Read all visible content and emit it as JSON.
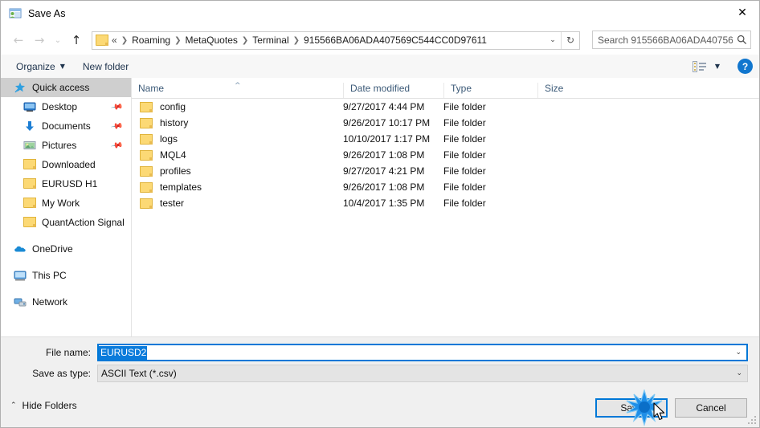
{
  "window": {
    "title": "Save As",
    "icon": "save-as-app-icon",
    "close_label": "✕"
  },
  "nav": {
    "back_icon": "arrow-left-icon",
    "forward_icon": "arrow-right-icon",
    "recent_icon": "chevron-down-icon",
    "up_icon": "arrow-up-icon",
    "back_glyph": "←",
    "forward_glyph": "→",
    "recent_glyph": "⌄",
    "up_glyph": "↑"
  },
  "address": {
    "folder_icon": "folder-icon",
    "lead": "«",
    "crumbs": [
      "Roaming",
      "MetaQuotes",
      "Terminal",
      "915566BA06ADA407569C544CC0D97611"
    ],
    "separator": "❯",
    "dropdown_glyph": "⌄",
    "refresh_glyph": "↻"
  },
  "search": {
    "placeholder": "Search 915566BA06ADA40756...",
    "icon_glyph": "🔍"
  },
  "toolbar": {
    "organize_label": "Organize",
    "organize_caret": "▼",
    "new_folder_label": "New folder",
    "view_caret": "▼",
    "help_label": "?"
  },
  "sidebar": {
    "items": [
      {
        "label": "Quick access",
        "icon": "star-pin-icon",
        "level": "root",
        "selected": true,
        "pinned": false
      },
      {
        "label": "Desktop",
        "icon": "desktop-icon",
        "level": "child",
        "selected": false,
        "pinned": true
      },
      {
        "label": "Documents",
        "icon": "documents-download-icon",
        "level": "child",
        "selected": false,
        "pinned": true
      },
      {
        "label": "Pictures",
        "icon": "pictures-icon",
        "level": "child",
        "selected": false,
        "pinned": true
      },
      {
        "label": "Downloaded",
        "icon": "folder-icon",
        "level": "child",
        "selected": false,
        "pinned": false
      },
      {
        "label": "EURUSD H1",
        "icon": "folder-icon",
        "level": "child",
        "selected": false,
        "pinned": false
      },
      {
        "label": "My Work",
        "icon": "folder-icon",
        "level": "child",
        "selected": false,
        "pinned": false
      },
      {
        "label": "QuantAction Signal",
        "icon": "folder-icon",
        "level": "child",
        "selected": false,
        "pinned": false
      },
      {
        "label": "OneDrive",
        "icon": "onedrive-cloud-icon",
        "level": "root",
        "selected": false,
        "pinned": false,
        "gap_before": true
      },
      {
        "label": "This PC",
        "icon": "this-pc-icon",
        "level": "root",
        "selected": false,
        "pinned": false,
        "gap_before": true
      },
      {
        "label": "Network",
        "icon": "network-icon",
        "level": "root",
        "selected": false,
        "pinned": false,
        "gap_before": true
      }
    ]
  },
  "filelist": {
    "columns": [
      "Name",
      "Date modified",
      "Type",
      "Size"
    ],
    "sort_caret": "^",
    "rows": [
      {
        "name": "config",
        "date": "9/27/2017 4:44 PM",
        "type": "File folder",
        "size": ""
      },
      {
        "name": "history",
        "date": "9/26/2017 10:17 PM",
        "type": "File folder",
        "size": ""
      },
      {
        "name": "logs",
        "date": "10/10/2017 1:17 PM",
        "type": "File folder",
        "size": ""
      },
      {
        "name": "MQL4",
        "date": "9/26/2017 1:08 PM",
        "type": "File folder",
        "size": ""
      },
      {
        "name": "profiles",
        "date": "9/27/2017 4:21 PM",
        "type": "File folder",
        "size": ""
      },
      {
        "name": "templates",
        "date": "9/26/2017 1:08 PM",
        "type": "File folder",
        "size": ""
      },
      {
        "name": "tester",
        "date": "10/4/2017 1:35 PM",
        "type": "File folder",
        "size": ""
      }
    ]
  },
  "form": {
    "filename_label": "File name:",
    "filename_value": "EURUSD2",
    "filetype_label": "Save as type:",
    "filetype_value": "ASCII Text (*.csv)",
    "caret_glyph": "⌄"
  },
  "footer": {
    "hide_folders_label": "Hide Folders",
    "hide_folders_caret": "⌃",
    "save_label": "Save",
    "cancel_label": "Cancel"
  },
  "colors": {
    "accent": "#0078d7",
    "selection": "#0a7bdb",
    "header_text": "#3c5a78",
    "folder_yellow": "#fcd975",
    "help_blue": "#1176ce",
    "sidebar_selected": "#cfcfcf",
    "chrome_grey": "#f0f0f0"
  }
}
